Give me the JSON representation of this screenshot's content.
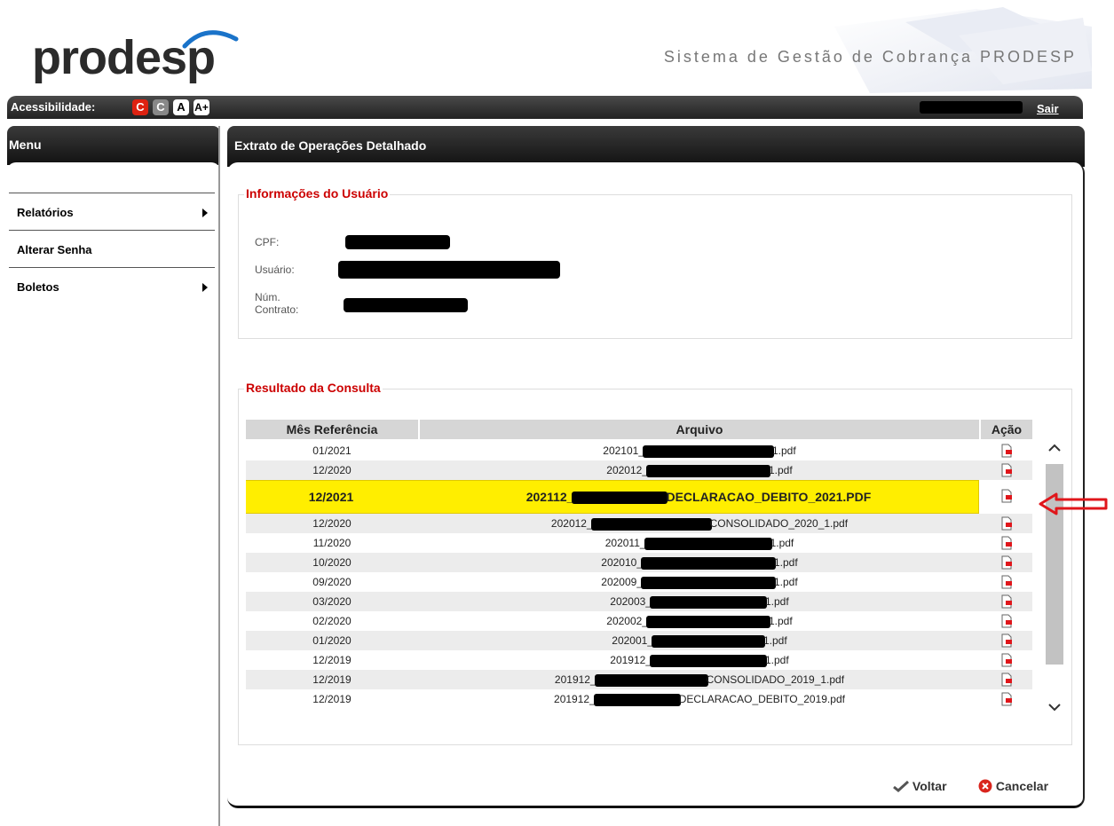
{
  "header": {
    "logo_text": "prodesp",
    "system_title": "Sistema de Gestão de Cobrança PRODESP"
  },
  "topbar": {
    "accessibility_label": "Acessibilidade:",
    "buttons": [
      "C",
      "C",
      "A",
      "A+"
    ],
    "logout_label": "Sair"
  },
  "sidebar": {
    "title": "Menu",
    "items": [
      {
        "label": "Relatórios",
        "has_submenu": true
      },
      {
        "label": "Alterar Senha",
        "has_submenu": false
      },
      {
        "label": "Boletos",
        "has_submenu": true
      }
    ]
  },
  "main": {
    "title": "Extrato de Operações Detalhado",
    "user_info": {
      "legend": "Informações do Usuário",
      "cpf_label": "CPF:",
      "user_label": "Usuário:",
      "contract_label": "Núm. Contrato:"
    },
    "results": {
      "legend": "Resultado da Consulta",
      "columns": [
        "Mês Referência",
        "Arquivo",
        "Ação"
      ],
      "rows": [
        {
          "month": "01/2021",
          "file_prefix": "202101_",
          "file_suffix": "1.pdf"
        },
        {
          "month": "12/2020",
          "file_prefix": "202012_",
          "file_suffix": "1.pdf"
        },
        {
          "month": "12/2021",
          "file_prefix": "202112_",
          "file_suffix": "DECLARACAO_DEBITO_2021.PDF",
          "highlighted": true
        },
        {
          "month": "12/2020",
          "file_prefix": "202012_",
          "file_suffix": "CONSOLIDADO_2020_1.pdf"
        },
        {
          "month": "11/2020",
          "file_prefix": "202011_",
          "file_suffix": "1.pdf"
        },
        {
          "month": "10/2020",
          "file_prefix": "202010_",
          "file_suffix": "1.pdf"
        },
        {
          "month": "09/2020",
          "file_prefix": "202009_",
          "file_suffix": "1.pdf"
        },
        {
          "month": "03/2020",
          "file_prefix": "202003_",
          "file_suffix": "1.pdf"
        },
        {
          "month": "02/2020",
          "file_prefix": "202002_",
          "file_suffix": "1.pdf"
        },
        {
          "month": "01/2020",
          "file_prefix": "202001_",
          "file_suffix": "1.pdf"
        },
        {
          "month": "12/2019",
          "file_prefix": "201912_",
          "file_suffix": "1.pdf"
        },
        {
          "month": "12/2019",
          "file_prefix": "201912_",
          "file_suffix": "CONSOLIDADO_2019_1.pdf"
        },
        {
          "month": "12/2019",
          "file_prefix": "201912_",
          "file_suffix": "DECLARACAO_DEBITO_2019.pdf"
        }
      ],
      "action_icon": "pdf-document-icon"
    },
    "actions": {
      "back_label": "Voltar",
      "cancel_label": "Cancelar"
    }
  },
  "colors": {
    "highlight": "#ffee00",
    "legend_red": "#cc0000",
    "arrow_red": "#e0161b",
    "header_dark": "#222222"
  }
}
